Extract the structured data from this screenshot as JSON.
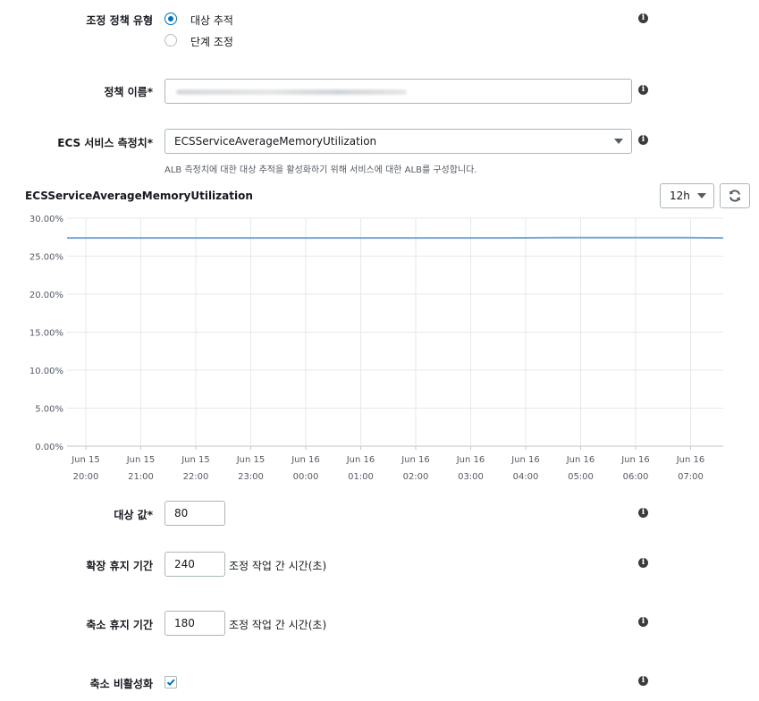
{
  "scaling_type": {
    "label": "조정 정책 유형",
    "options": [
      {
        "label": "대상 추적",
        "selected": true
      },
      {
        "label": "단계 조정",
        "selected": false
      }
    ]
  },
  "policy_name": {
    "label": "정책 이름*"
  },
  "ecs_metric": {
    "label": "ECS 서비스 측정치*",
    "selected": "ECSServiceAverageMemoryUtilization",
    "hint": "ALB 측정치에 대한 대상 추적을 활성화하기 위해 서비스에 대한 ALB를 구성합니다."
  },
  "chart_controls": {
    "period": "12h",
    "refresh_icon": "refresh-icon"
  },
  "chart_data": {
    "type": "line",
    "title": "ECSServiceAverageMemoryUtilization",
    "y_ticks": [
      "30.00%",
      "25.00%",
      "20.00%",
      "15.00%",
      "10.00%",
      "5.00%",
      "0.00%"
    ],
    "ylim": [
      0,
      30
    ],
    "x_ticks": [
      {
        "d": "Jun 15",
        "t": "20:00"
      },
      {
        "d": "Jun 15",
        "t": "21:00"
      },
      {
        "d": "Jun 15",
        "t": "22:00"
      },
      {
        "d": "Jun 15",
        "t": "23:00"
      },
      {
        "d": "Jun 16",
        "t": "00:00"
      },
      {
        "d": "Jun 16",
        "t": "01:00"
      },
      {
        "d": "Jun 16",
        "t": "02:00"
      },
      {
        "d": "Jun 16",
        "t": "03:00"
      },
      {
        "d": "Jun 16",
        "t": "04:00"
      },
      {
        "d": "Jun 16",
        "t": "05:00"
      },
      {
        "d": "Jun 16",
        "t": "06:00"
      },
      {
        "d": "Jun 16",
        "t": "07:00"
      }
    ],
    "series": [
      {
        "values": [
          27.4,
          27.4,
          27.4,
          27.4,
          27.4,
          27.4,
          27.4,
          27.4,
          27.4,
          27.45,
          27.45,
          27.45,
          27.4
        ],
        "color": "#77a6d6"
      }
    ],
    "grid": true
  },
  "target_value": {
    "label": "대상 값*",
    "value": "80"
  },
  "scale_out_cooldown": {
    "label": "확장 휴지 기간",
    "value": "240",
    "unit": "조정 작업 간 시간(초)"
  },
  "scale_in_cooldown": {
    "label": "축소 휴지 기간",
    "value": "180",
    "unit": "조정 작업 간 시간(초)"
  },
  "disable_scale_in": {
    "label": "축소 비활성화",
    "checked": true
  },
  "info_icon_glyph": "i",
  "accent_color": "#0073bb"
}
